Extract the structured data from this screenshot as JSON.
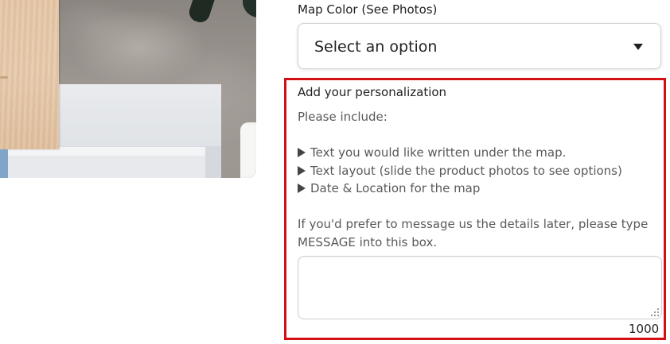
{
  "product_image": {
    "alt": "Product photo"
  },
  "map_color": {
    "label": "Map Color (See Photos)",
    "selected": "Select an option",
    "caret_icon": "caret-down-icon"
  },
  "personalization": {
    "title": "Add your personalization",
    "intro": "Please include:",
    "bullets": [
      "Text you would like written under the map.",
      "Text layout (slide the product photos to see options)",
      "Date & Location for the map"
    ],
    "bullet_icon": "triangle-right-icon",
    "note": "If you'd prefer to message us the details later, please type MESSAGE into this box.",
    "input_value": "",
    "char_count": "1000"
  },
  "colors": {
    "highlight": "#d40f14",
    "text": "#222222",
    "muted_text": "#595959"
  }
}
